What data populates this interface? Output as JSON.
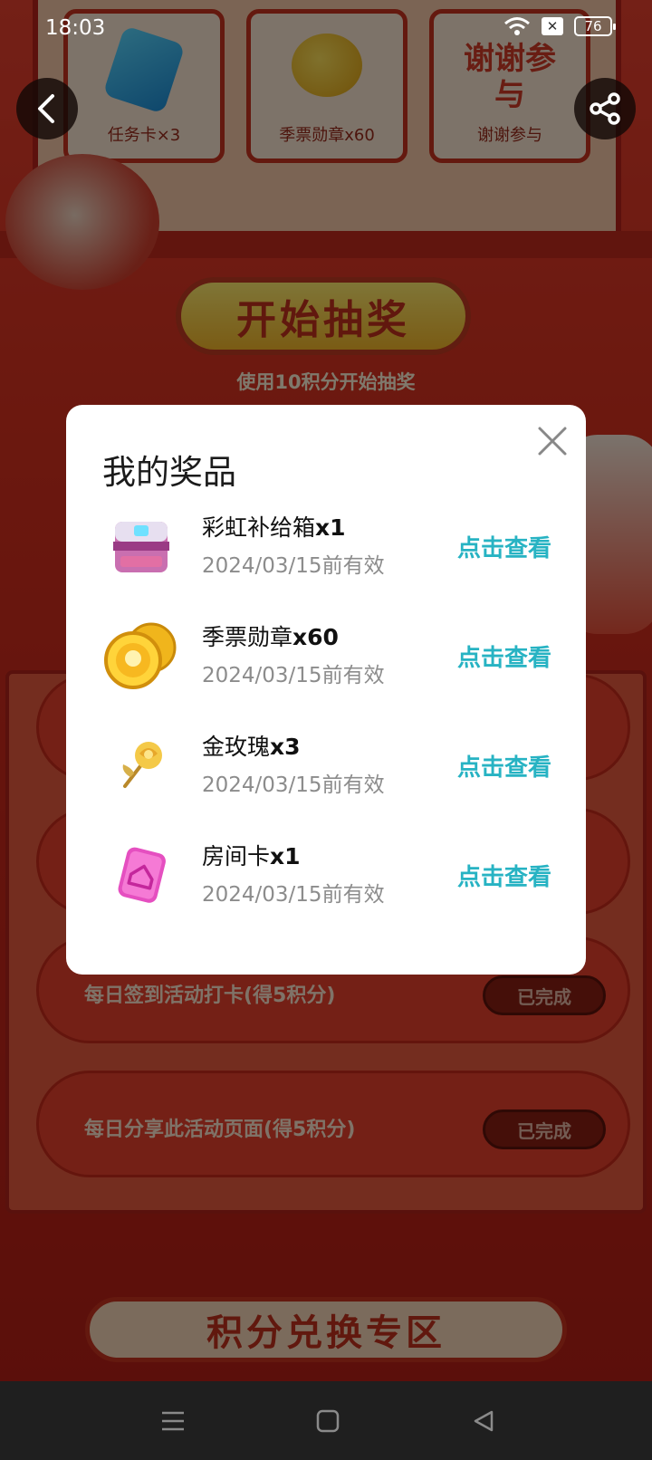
{
  "status_bar": {
    "time": "18:03",
    "battery": "76"
  },
  "background": {
    "prize_cards": [
      {
        "label": "任务卡×3",
        "icon": "task-card-icon"
      },
      {
        "label": "季票勋章x60",
        "icon": "season-medal-icon"
      },
      {
        "label": "谢谢参与",
        "icon": "thanks-text-icon",
        "art_text": "谢谢参与"
      }
    ],
    "draw_button": "开始抽奖",
    "draw_subtitle": "使用10积分开始抽奖",
    "tasks": [
      {
        "text": "每日签到活动打卡(得5积分)",
        "status": "已完成"
      },
      {
        "text": "每日分享此活动页面(得5积分)",
        "status": "已完成"
      }
    ],
    "exchange_title": "积分兑换专区"
  },
  "modal": {
    "title": "我的奖品",
    "items": [
      {
        "name": "彩虹补给箱",
        "qty": "x1",
        "expiry": "2024/03/15前有效",
        "action": "点击查看",
        "icon": "supply-box-icon"
      },
      {
        "name": "季票勋章",
        "qty": "x60",
        "expiry": "2024/03/15前有效",
        "action": "点击查看",
        "icon": "season-medal-icon"
      },
      {
        "name": "金玫瑰",
        "qty": "x3",
        "expiry": "2024/03/15前有效",
        "action": "点击查看",
        "icon": "golden-rose-icon"
      },
      {
        "name": "房间卡",
        "qty": "x1",
        "expiry": "2024/03/15前有效",
        "action": "点击查看",
        "icon": "room-card-icon"
      }
    ]
  },
  "colors": {
    "accent": "#27b3c3",
    "page_red": "#d8311f",
    "modal_bg": "#ffffff"
  }
}
